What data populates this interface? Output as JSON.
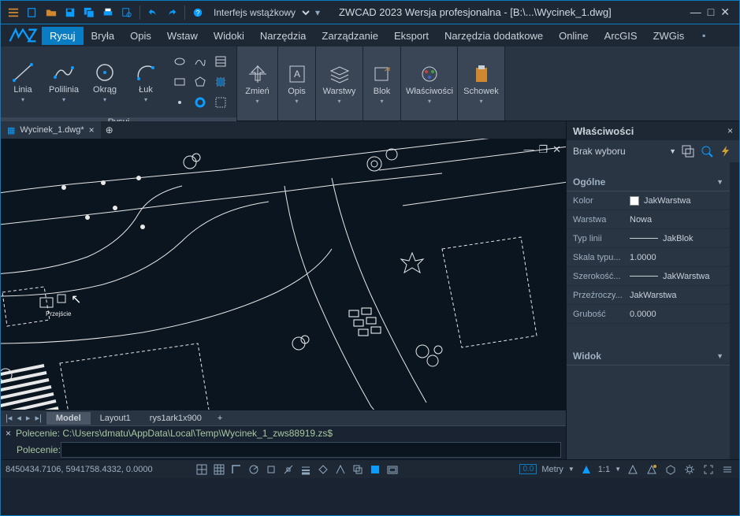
{
  "title": "ZWCAD 2023 Wersja profesjonalna - [B:\\...\\Wycinek_1.dwg]",
  "interface_mode": "Interfejs wstążkowy",
  "menu": [
    "Rysuj",
    "Bryła",
    "Opis",
    "Wstaw",
    "Widoki",
    "Narzędzia",
    "Zarządzanie",
    "Eksport",
    "Narzędzia dodatkowe",
    "Online",
    "ArcGIS",
    "ZWGis"
  ],
  "menu_active": 0,
  "ribbon": {
    "draw": {
      "linia": "Linia",
      "polilinia": "Polilinia",
      "okrag": "Okrąg",
      "luk": "Łuk",
      "label": "Rysuj"
    },
    "panels": [
      "Zmień",
      "Opis",
      "Warstwy",
      "Blok",
      "Właściwości",
      "Schowek"
    ]
  },
  "doc_tab": "Wycinek_1.dwg*",
  "layout_tabs": [
    "Model",
    "Layout1",
    "rys1ark1x900"
  ],
  "layout_active": 0,
  "cmd_history": "Polecenie: C:\\Users\\dmatu\\AppData\\Local\\Temp\\Wycinek_1_zws88919.zs$",
  "cmd_prompt": "Polecenie: ",
  "properties": {
    "title": "Właściwości",
    "selection": "Brak wyboru",
    "section_general": "Ogólne",
    "section_view": "Widok",
    "rows": {
      "kolor": {
        "k": "Kolor",
        "v": "JakWarstwa"
      },
      "warstwa": {
        "k": "Warstwa",
        "v": "Nowa"
      },
      "typlinii": {
        "k": "Typ linii",
        "v": "JakBlok"
      },
      "skala": {
        "k": "Skala typu...",
        "v": "1.0000"
      },
      "szer": {
        "k": "Szerokość...",
        "v": "JakWarstwa"
      },
      "przez": {
        "k": "Przeźroczy...",
        "v": "JakWarstwa"
      },
      "grub": {
        "k": "Grubość",
        "v": "0.0000"
      }
    }
  },
  "status": {
    "coords": "8450434.7106, 5941758.4332, 0.0000",
    "units": "Metry",
    "scale": "1:1"
  }
}
